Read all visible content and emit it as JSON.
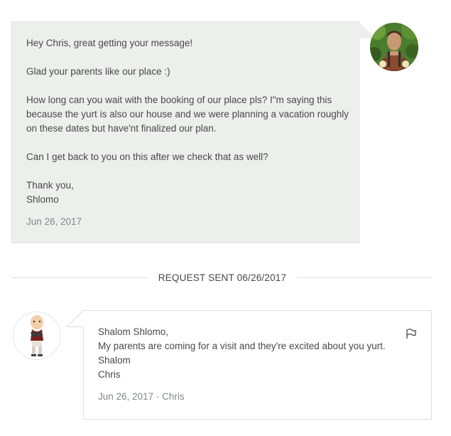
{
  "host_message": {
    "greeting": "Hey Chris, great getting your message!",
    "line2": "Glad your parents like our place :)",
    "paragraph3": "How long can you wait with the booking of our place pls? I\"m saying this because the yurt is also our house and we were planning a vacation roughly on these dates but have'nt finalized our plan.",
    "paragraph4": "Can I get back to you on this after we check that as well?",
    "signoff_1": "Thank you,",
    "signoff_2": "Shlomo",
    "date": "Jun 26, 2017"
  },
  "divider": {
    "label": "REQUEST SENT 06/26/2017"
  },
  "guest_message": {
    "line1": "Shalom Shlomo,",
    "line2": "My parents are coming for a visit and they're excited about you yurt.",
    "line3": "Shalom",
    "line4": "Chris",
    "date": "Jun 26, 2017 · Chris"
  },
  "colors": {
    "host_bubble_bg": "#edefed",
    "border": "#dce0e0",
    "text": "#484848",
    "muted_text": "#82888a"
  },
  "icons": {
    "host_avatar": "host-avatar-photo",
    "guest_avatar": "guest-avatar-figure",
    "report": "flag-icon"
  }
}
